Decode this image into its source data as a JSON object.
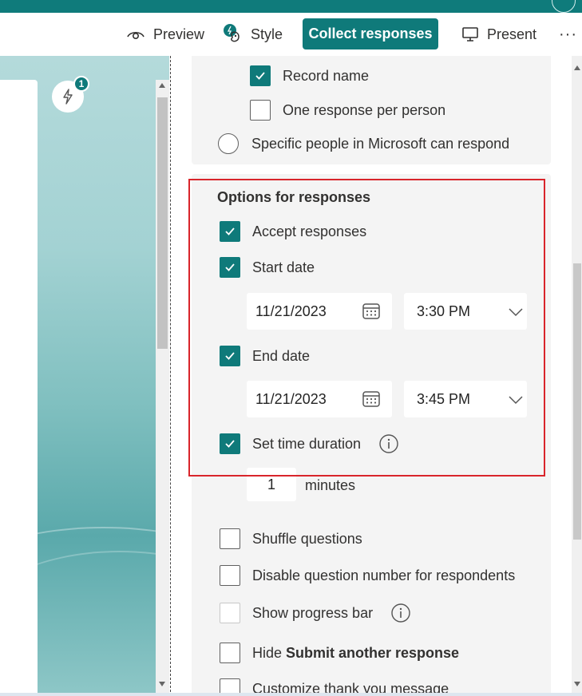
{
  "toolbar": {
    "preview_label": "Preview",
    "style_label": "Style",
    "collect_label": "Collect responses",
    "present_label": "Present",
    "more_label": "···"
  },
  "canvas": {
    "badge_count": "1"
  },
  "who_can_respond": {
    "record_name": {
      "label": "Record name",
      "checked": true
    },
    "one_response": {
      "label": "One response per person",
      "checked": false
    },
    "specific_people": {
      "label": "Specific people in Microsoft can respond",
      "selected": false
    }
  },
  "options": {
    "title": "Options for responses",
    "accept_responses": {
      "label": "Accept responses",
      "checked": true
    },
    "start_date": {
      "label": "Start date",
      "checked": true,
      "date": "11/21/2023",
      "time": "3:30 PM"
    },
    "end_date": {
      "label": "End date",
      "checked": true,
      "date": "11/21/2023",
      "time": "3:45 PM"
    },
    "time_duration": {
      "label": "Set time duration",
      "checked": true,
      "value": "1",
      "unit": "minutes"
    },
    "shuffle": {
      "label": "Shuffle questions",
      "checked": false
    },
    "disable_numbers": {
      "label": "Disable question number for respondents",
      "checked": false
    },
    "progress_bar": {
      "label": "Show progress bar",
      "checked": false,
      "disabled": true
    },
    "hide_submit": {
      "prefix": "Hide",
      "bold": "Submit another response",
      "checked": false
    },
    "thank_you": {
      "label": "Customize thank you message",
      "checked": false
    }
  },
  "colors": {
    "accent": "#0f7a7a",
    "highlight_border": "#d9252b",
    "panel_section": "#f4f4f4"
  }
}
